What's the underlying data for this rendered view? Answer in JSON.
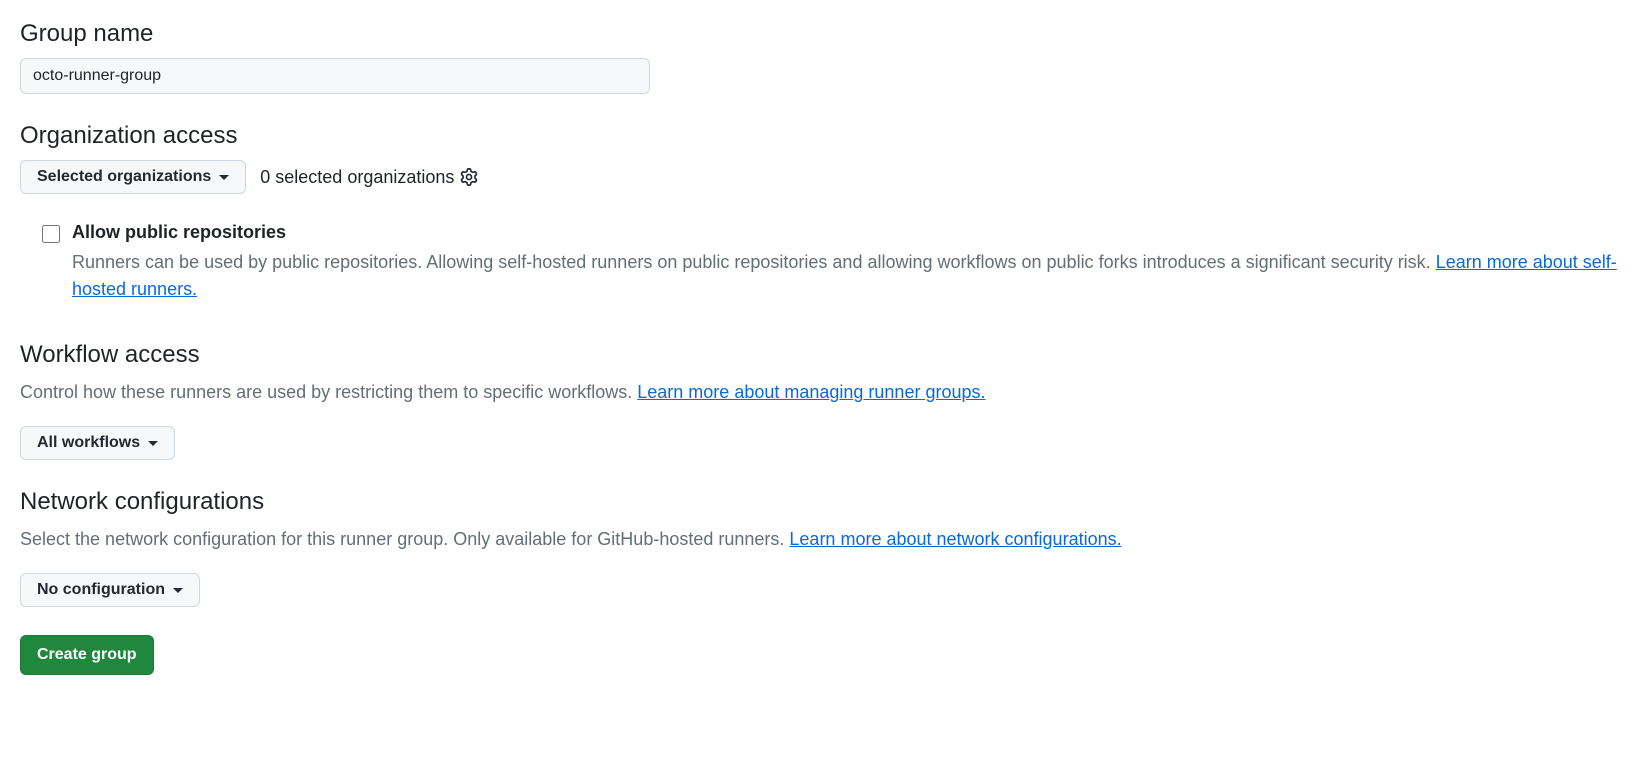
{
  "groupName": {
    "label": "Group name",
    "value": "octo-runner-group"
  },
  "orgAccess": {
    "label": "Organization access",
    "dropdown": "Selected organizations",
    "selectedCount": "0 selected organizations",
    "allowPublic": {
      "label": "Allow public repositories",
      "description": "Runners can be used by public repositories. Allowing self-hosted runners on public repositories and allowing workflows on public forks introduces a significant security risk. ",
      "link": "Learn more about self-hosted runners."
    }
  },
  "workflowAccess": {
    "label": "Workflow access",
    "description": "Control how these runners are used by restricting them to specific workflows. ",
    "link": "Learn more about managing runner groups.",
    "dropdown": "All workflows"
  },
  "networkConfig": {
    "label": "Network configurations",
    "description": "Select the network configuration for this runner group. Only available for GitHub-hosted runners. ",
    "link": "Learn more about network configurations.",
    "dropdown": "No configuration"
  },
  "createButton": "Create group"
}
